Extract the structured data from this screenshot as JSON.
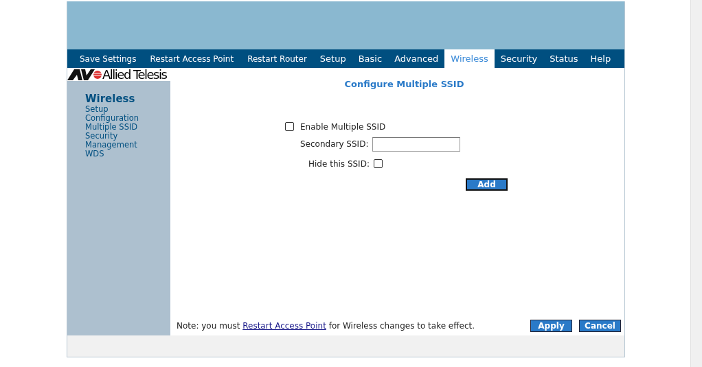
{
  "top_nav": [
    {
      "label": "Save Settings",
      "selected": false,
      "kind": "action"
    },
    {
      "label": "Restart Access Point",
      "selected": false,
      "kind": "action"
    },
    {
      "label": "Restart Router",
      "selected": false,
      "kind": "action"
    },
    {
      "label": "Setup",
      "selected": false,
      "kind": "menu"
    },
    {
      "label": "Basic",
      "selected": false,
      "kind": "menu"
    },
    {
      "label": "Advanced",
      "selected": false,
      "kind": "menu"
    },
    {
      "label": "Wireless",
      "selected": true,
      "kind": "menu"
    },
    {
      "label": "Security",
      "selected": false,
      "kind": "menu"
    },
    {
      "label": "Status",
      "selected": false,
      "kind": "menu"
    },
    {
      "label": "Help",
      "selected": false,
      "kind": "menu"
    }
  ],
  "logo": {
    "text": "Allied Telesis"
  },
  "sidebar": {
    "heading": "Wireless",
    "items": [
      "Setup",
      "Configuration",
      "Multiple SSID",
      "Security",
      "Management",
      "WDS"
    ]
  },
  "page_title": "Configure Multiple SSID",
  "form": {
    "enable_multiple_ssid": {
      "label": "Enable Multiple SSID",
      "checked": false
    },
    "secondary_ssid": {
      "label": "Secondary SSID:"
    },
    "hide_ssid": {
      "label": "Hide this SSID:",
      "checked": false
    },
    "add_button": "Add"
  },
  "note": {
    "before": "Note: you must",
    "link": "Restart Access Point",
    "after": "for Wireless changes to take effect."
  },
  "buttons": [
    "Apply",
    "Cancel"
  ]
}
